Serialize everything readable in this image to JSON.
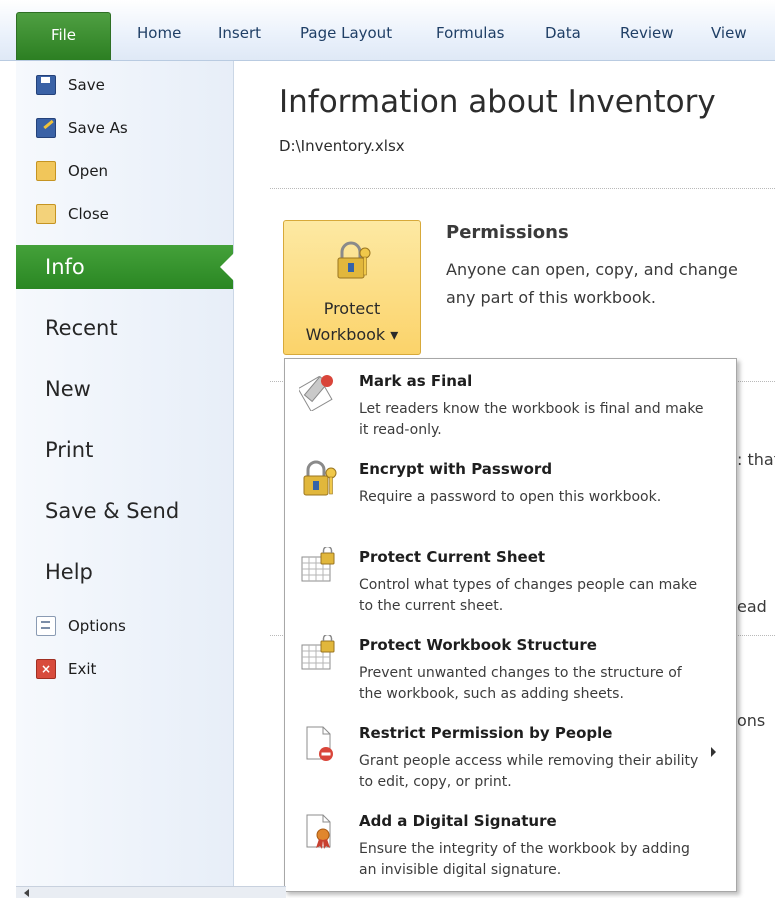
{
  "ribbon": {
    "tabs": [
      "File",
      "Home",
      "Insert",
      "Page Layout",
      "Formulas",
      "Data",
      "Review",
      "View"
    ]
  },
  "nav": {
    "small_top": [
      {
        "label": "Save",
        "icon": "save-icon"
      },
      {
        "label": "Save As",
        "icon": "save-as-icon"
      },
      {
        "label": "Open",
        "icon": "open-folder-icon"
      },
      {
        "label": "Close",
        "icon": "close-folder-icon"
      }
    ],
    "big": [
      "Info",
      "Recent",
      "New",
      "Print",
      "Save & Send",
      "Help"
    ],
    "selected": "Info",
    "small_bottom": [
      {
        "label": "Options",
        "icon": "options-icon"
      },
      {
        "label": "Exit",
        "icon": "exit-icon"
      }
    ]
  },
  "main": {
    "title": "Information about Inventory",
    "path": "D:\\Inventory.xlsx",
    "protect_button": {
      "line1": "Protect",
      "line2": "Workbook ▾"
    },
    "permissions": {
      "title": "Permissions",
      "desc_line1": "Anyone can open, copy, and change",
      "desc_line2": "any part of this workbook."
    },
    "peek": {
      "a": ": that",
      "b": "ead",
      "c": "ons"
    }
  },
  "menu": {
    "items": [
      {
        "title": "Mark as Final",
        "desc": "Let readers know the workbook is final and make it read-only.",
        "icon": "mark-final-icon",
        "submenu": false
      },
      {
        "title": "Encrypt with Password",
        "desc": "Require a password to open this workbook.",
        "icon": "encrypt-lock-icon",
        "submenu": false
      },
      {
        "title": "Protect Current Sheet",
        "desc": "Control what types of changes people can make to the current sheet.",
        "icon": "protect-sheet-icon",
        "submenu": false
      },
      {
        "title": "Protect Workbook Structure",
        "desc": "Prevent unwanted changes to the structure of the workbook, such as adding sheets.",
        "icon": "protect-structure-icon",
        "submenu": false
      },
      {
        "title": "Restrict Permission by People",
        "desc": "Grant people access while removing their ability to edit, copy, or print.",
        "icon": "restrict-permission-icon",
        "submenu": true
      },
      {
        "title": "Add a Digital Signature",
        "desc": "Ensure the integrity of the workbook by adding an invisible digital signature.",
        "icon": "digital-signature-icon",
        "submenu": false
      }
    ]
  },
  "colors": {
    "accent": "#2e8b25",
    "button": "#fbd36a"
  }
}
